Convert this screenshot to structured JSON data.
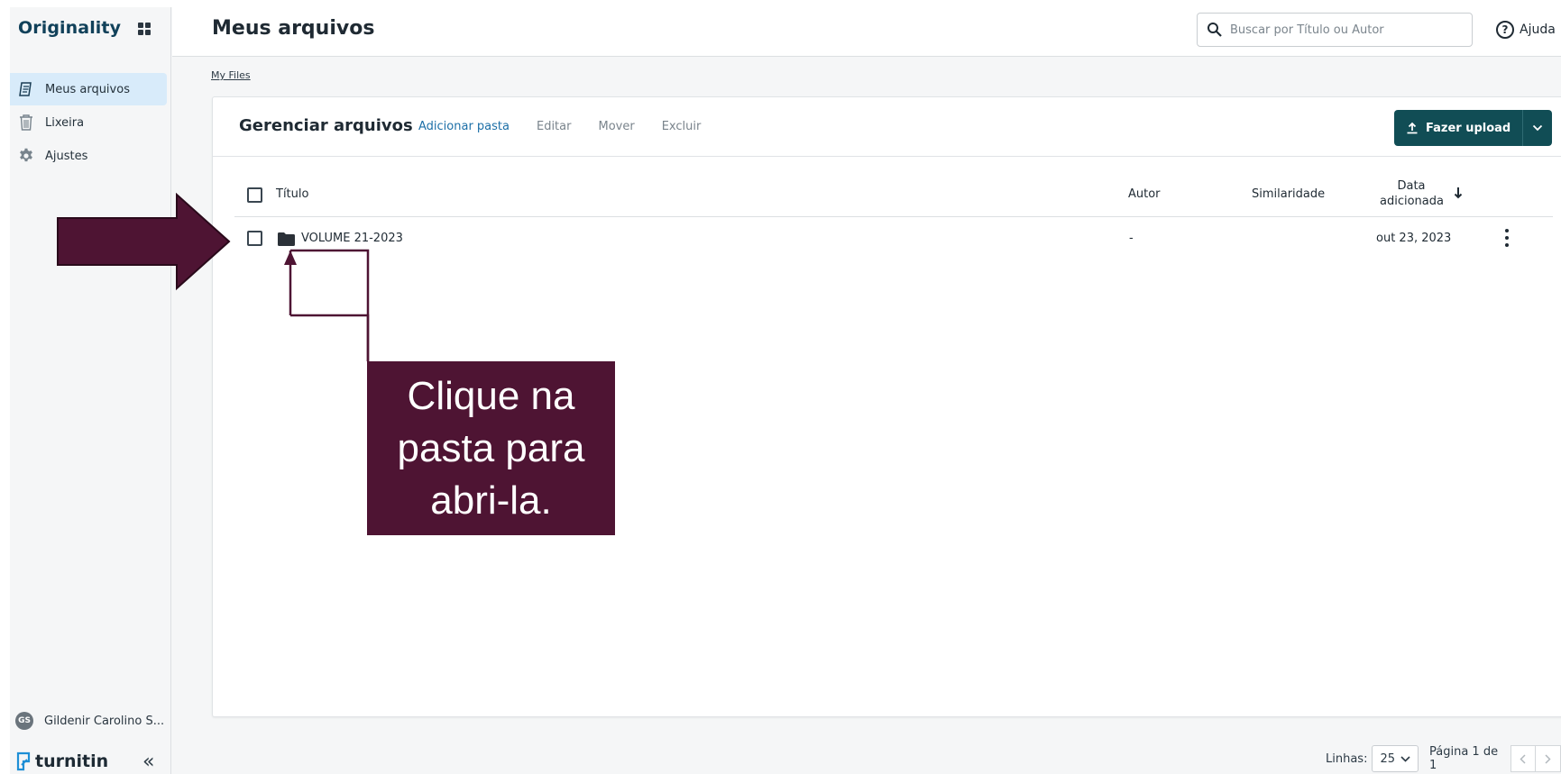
{
  "app": {
    "brand": "Originality",
    "page_title": "Meus arquivos"
  },
  "sidebar": {
    "items": [
      {
        "label": "Meus arquivos",
        "icon": "document-icon",
        "active": true
      },
      {
        "label": "Lixeira",
        "icon": "trash-icon",
        "active": false
      },
      {
        "label": "Ajustes",
        "icon": "gear-icon",
        "active": false
      }
    ],
    "user": {
      "initials": "GS",
      "name": "Gildenir Carolino S..."
    },
    "logo_text": "turnitin",
    "collapse_glyph": "«"
  },
  "search": {
    "placeholder": "Buscar por Título ou Autor",
    "value": ""
  },
  "help_label": "Ajuda",
  "breadcrumb": "My Files",
  "manager": {
    "title": "Gerenciar arquivos",
    "actions": {
      "add_folder": "Adicionar pasta",
      "edit": "Editar",
      "move": "Mover",
      "delete": "Excluir"
    },
    "upload_label": "Fazer upload"
  },
  "table": {
    "columns": {
      "title": "Título",
      "author": "Autor",
      "similarity": "Similaridade",
      "date_line1": "Data",
      "date_line2": "adicionada"
    },
    "rows": [
      {
        "name": "VOLUME 21-2023",
        "author": "-",
        "similarity": "",
        "date": "out 23, 2023"
      }
    ]
  },
  "pagination": {
    "rows_label": "Linhas:",
    "rows_value": "25",
    "page_label": "Página 1 de 1"
  },
  "annotation": {
    "text": "Clique na pasta para abri-la.",
    "color": "#4e1433"
  },
  "colors": {
    "brand": "#11415a",
    "primary_button": "#114d55",
    "active_nav": "#d8ebfa",
    "link": "#1c6fa7"
  }
}
